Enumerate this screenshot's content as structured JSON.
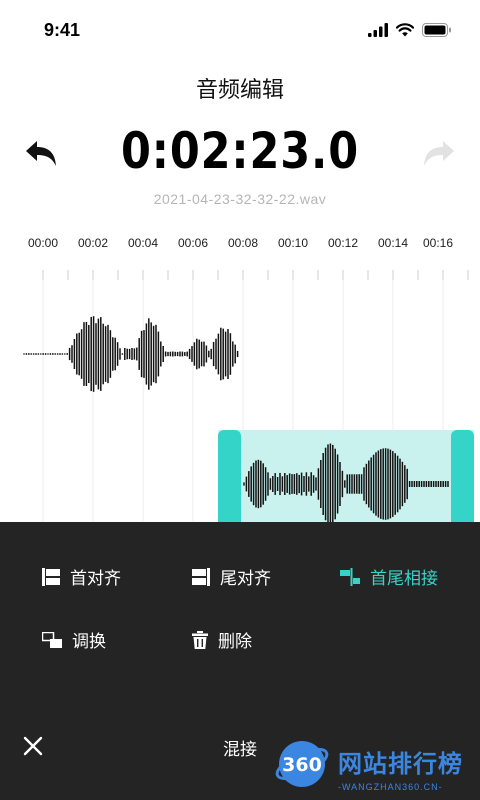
{
  "status": {
    "time": "9:41"
  },
  "header": {
    "title": "音频编辑",
    "timer": "0:02:23.0",
    "filename": "2021-04-23-32-32-22.wav"
  },
  "ruler": {
    "ticks": [
      "00:00",
      "00:02",
      "00:04",
      "00:06",
      "00:08",
      "00:10",
      "00:12",
      "00:14",
      "00:16"
    ]
  },
  "colors": {
    "accent": "#35d4c8",
    "selection_fill": "#c9f2ef",
    "sheet_bg": "#242424"
  },
  "sheet": {
    "title": "混接",
    "options": [
      {
        "label": "首对齐",
        "icon": "align-start-icon",
        "active": false
      },
      {
        "label": "尾对齐",
        "icon": "align-end-icon",
        "active": false
      },
      {
        "label": "首尾相接",
        "icon": "join-icon",
        "active": true
      },
      {
        "label": "调换",
        "icon": "swap-icon",
        "active": false
      },
      {
        "label": "删除",
        "icon": "trash-icon",
        "active": false
      }
    ]
  },
  "watermark": {
    "logo": "360",
    "text": "网站排行榜",
    "sub": "-WANGZHAN360.CN-"
  }
}
